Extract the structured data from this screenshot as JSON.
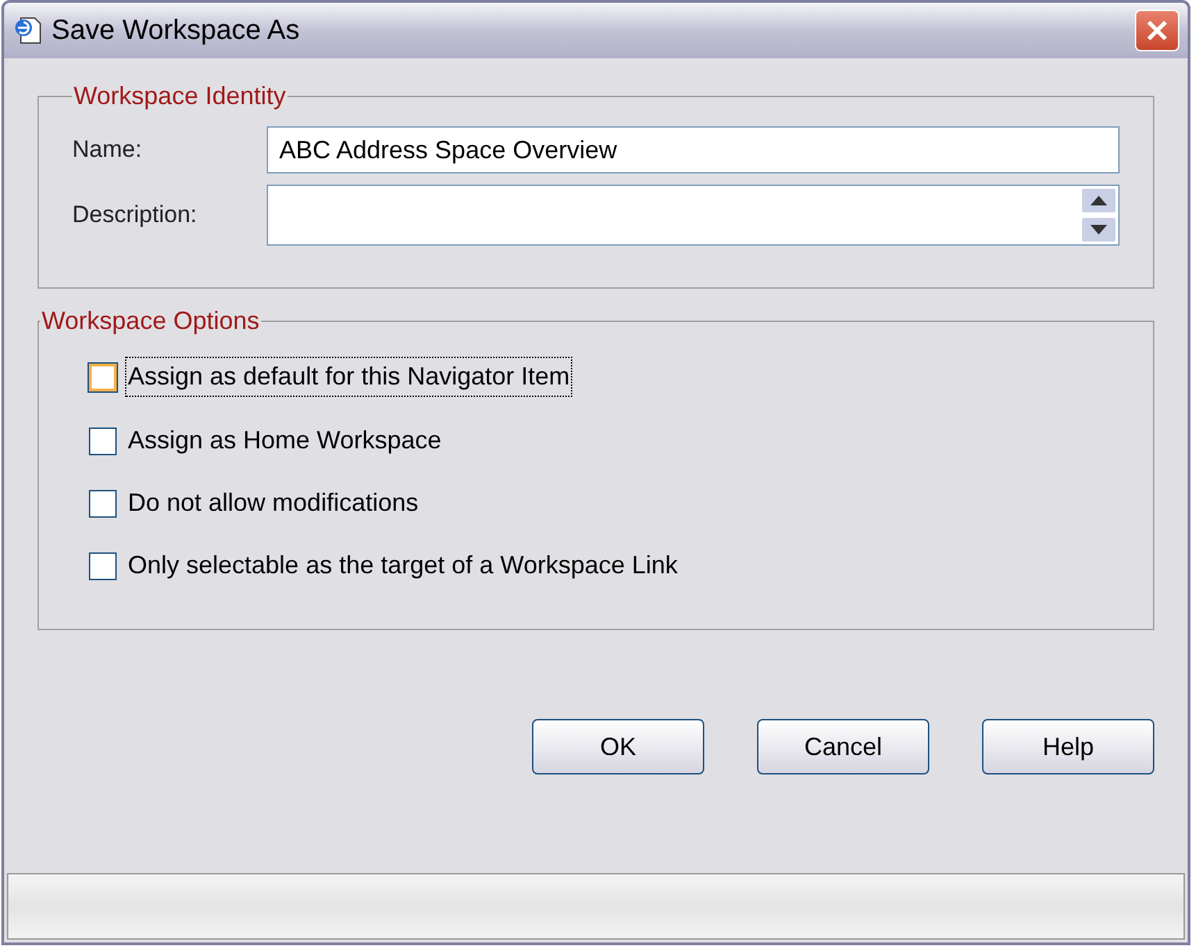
{
  "window": {
    "title": "Save Workspace As"
  },
  "identity": {
    "legend": "Workspace Identity",
    "name_label": "Name:",
    "name_value": "ABC Address Space Overview",
    "description_label": "Description:"
  },
  "options": {
    "legend": "Workspace Options",
    "items": [
      {
        "label": "Assign as default for this Navigator Item",
        "checked": false,
        "focused": true
      },
      {
        "label": "Assign as Home Workspace",
        "checked": false,
        "focused": false
      },
      {
        "label": "Do not allow modifications",
        "checked": false,
        "focused": false
      },
      {
        "label": "Only selectable as the target of a Workspace Link",
        "checked": false,
        "focused": false
      }
    ]
  },
  "buttons": [
    "OK",
    "Cancel",
    "Help"
  ]
}
